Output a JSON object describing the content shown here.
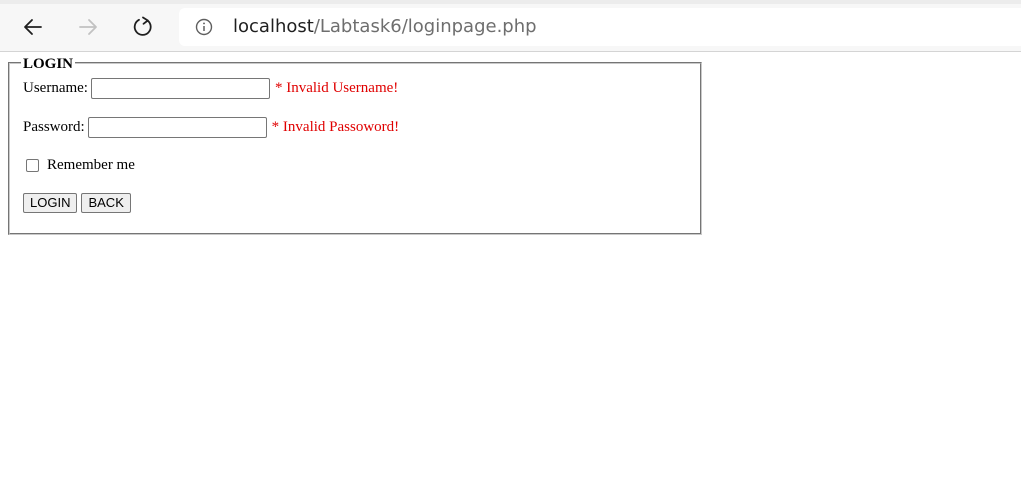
{
  "browser": {
    "url_host": "localhost",
    "url_path": "/Labtask6/loginpage.php",
    "icons": [
      "back-arrow-icon",
      "forward-arrow-icon",
      "reload-icon",
      "info-icon"
    ]
  },
  "form": {
    "legend": "LOGIN",
    "username_label": "Username:",
    "username_value": "",
    "username_error": "* Invalid Username!",
    "password_label": "Password:",
    "password_value": "",
    "password_error": "* Invalid Passoword!",
    "remember_label": "Remember me",
    "remember_checked": false,
    "login_button": "LOGIN",
    "back_button": "BACK"
  },
  "colors": {
    "error": "#e00000",
    "fieldset_border": "#c9c9c9"
  }
}
